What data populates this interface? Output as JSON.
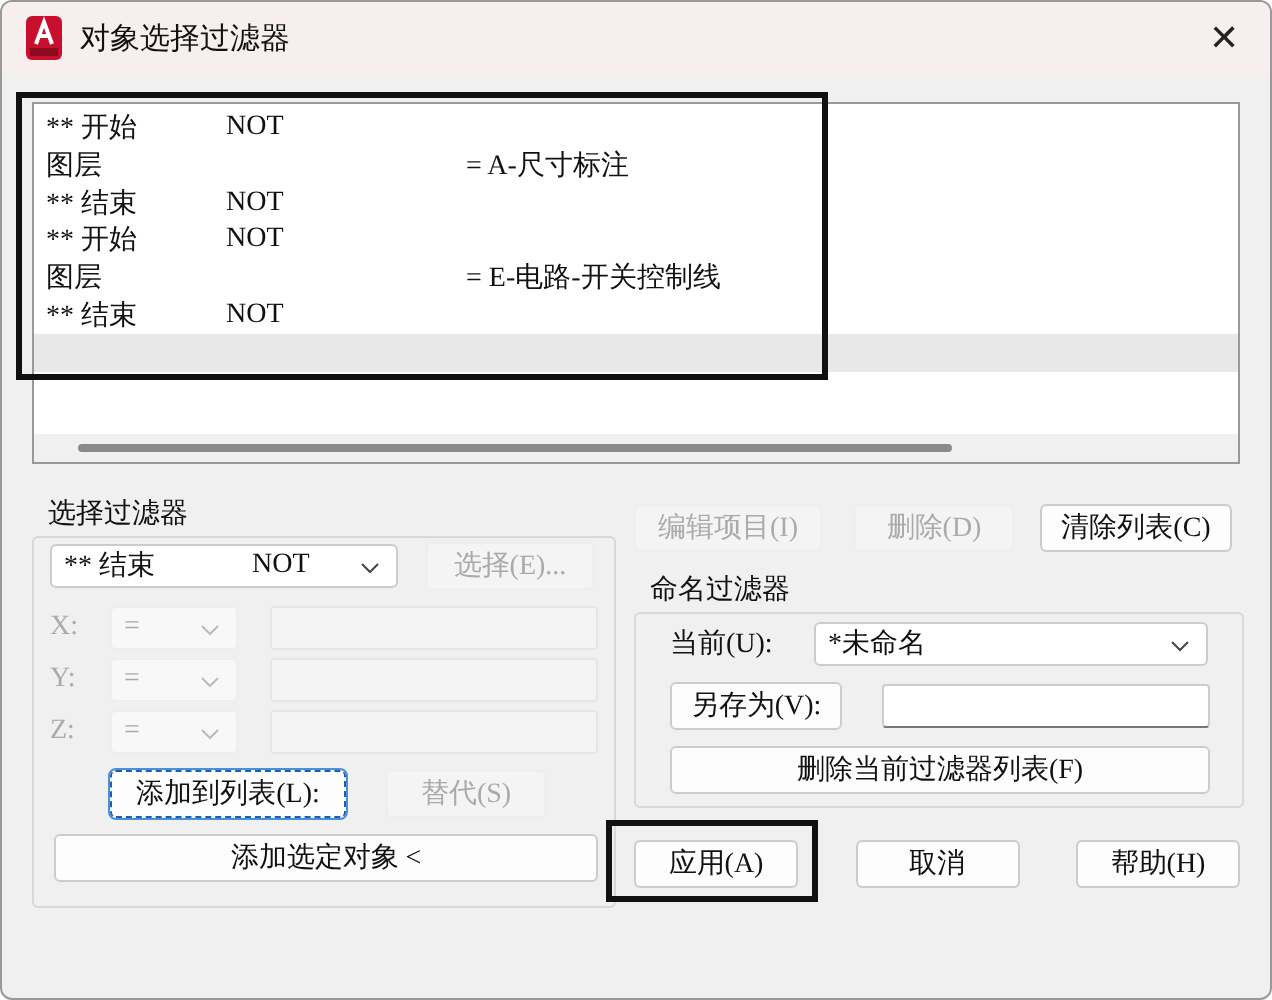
{
  "window": {
    "title": "对象选择过滤器",
    "close": "✕"
  },
  "filter_list": {
    "callout": true,
    "rows": [
      {
        "col1": "** 开始",
        "col2": "NOT",
        "selected": false
      },
      {
        "col1": "图层",
        "col3": "= A-尺寸标注",
        "selected": false
      },
      {
        "col1": "** 结束",
        "col2": "NOT",
        "selected": false
      },
      {
        "col1": "** 开始",
        "col2": "NOT",
        "selected": false
      },
      {
        "col1": "图层",
        "col3": "= E-电路-开关控制线",
        "selected": false
      },
      {
        "col1": "** 结束",
        "col2": "NOT",
        "selected": false
      },
      {
        "selected": true
      }
    ]
  },
  "select_filter": {
    "title": "选择过滤器",
    "combo": {
      "value1": "** 结束",
      "value2": "NOT"
    },
    "select_button": {
      "label": "选择(E)...",
      "disabled": true
    },
    "coords": [
      {
        "label": "X:",
        "op": "=",
        "disabled": true
      },
      {
        "label": "Y:",
        "op": "=",
        "disabled": true
      },
      {
        "label": "Z:",
        "op": "=",
        "disabled": true
      }
    ],
    "add_to_list": {
      "label": "添加到列表(L):",
      "disabled": false,
      "focused": true
    },
    "substitute": {
      "label": "替代(S)",
      "disabled": true
    },
    "add_selected": {
      "label": "添加选定对象 <",
      "disabled": false
    }
  },
  "list_buttons": [
    {
      "label": "编辑项目(I)",
      "disabled": true
    },
    {
      "label": "删除(D)",
      "disabled": true
    },
    {
      "label": "清除列表(C)",
      "disabled": false
    }
  ],
  "named_filter": {
    "title": "命名过滤器",
    "current_label": "当前(U):",
    "current_value": "*未命名",
    "save_as": "另存为(V):",
    "delete_list": "删除当前过滤器列表(F)"
  },
  "bottom_buttons": [
    "应用(A)",
    "取消",
    "帮助(H)"
  ],
  "apply_button_callout": true
}
